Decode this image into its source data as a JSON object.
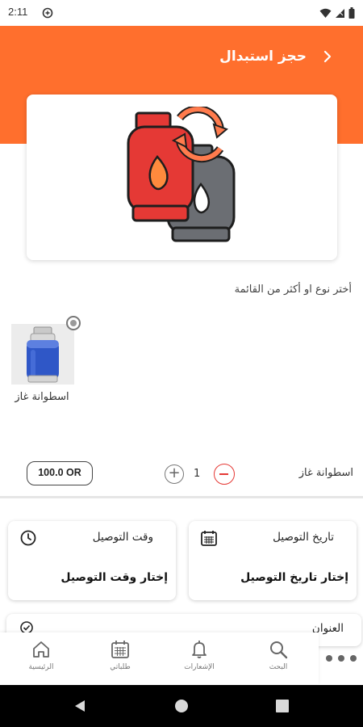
{
  "status_bar": {
    "time": "2:11",
    "icons": [
      "data-saver-icon",
      "wifi-icon",
      "signal-icon",
      "battery-icon"
    ]
  },
  "header": {
    "title": "حجز استبدال",
    "back_icon": "chevron-right-icon",
    "color": "#ff6f2d"
  },
  "hero": {
    "image": "gas-cylinder-exchange-illustration"
  },
  "selection": {
    "instruction": "أختر نوع او أكثر من القائمة",
    "items": [
      {
        "label": "اسطوانة غاز",
        "image": "blue-gas-cylinder-photo"
      }
    ]
  },
  "summary": {
    "item_label": "اسطوانة غاز",
    "quantity": "1",
    "price": "100.0 OR"
  },
  "delivery": {
    "date_title": "تاريخ التوصيل",
    "date_placeholder": "إختار تاريخ التوصيل",
    "time_title": "وقت التوصيل",
    "time_placeholder": "إختار وقت التوصيل",
    "address_title": "العنوان"
  },
  "bottom_nav": {
    "items": [
      {
        "label": "البحث",
        "icon": "search-icon"
      },
      {
        "label": "الإشعارات",
        "icon": "bell-icon"
      },
      {
        "label": "طلباتي",
        "icon": "calendar-icon"
      },
      {
        "label": "الرئيسية",
        "icon": "home-icon"
      }
    ],
    "more_icon": "more-dots-icon"
  },
  "colors": {
    "accent": "#ff6f2d",
    "danger": "#e53935"
  }
}
